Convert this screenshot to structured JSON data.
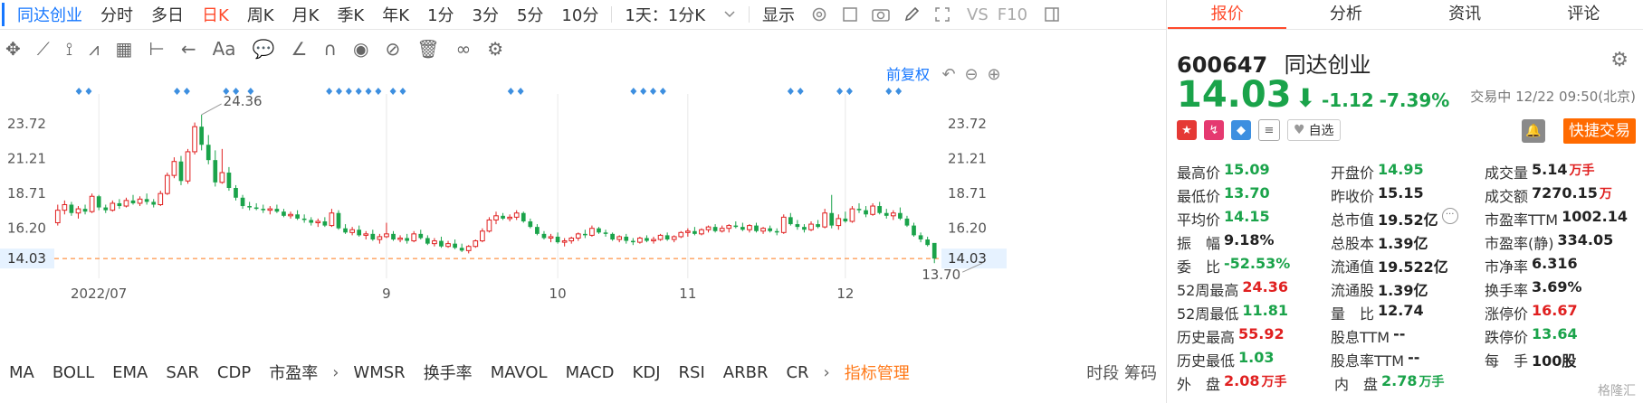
{
  "toolbar": {
    "stock_tab": "同达创业",
    "periods": [
      "分时",
      "多日",
      "日K",
      "周K",
      "月K",
      "季K",
      "年K",
      "1分",
      "3分",
      "5分",
      "10分"
    ],
    "active_period": "日K",
    "range_select": "1天：1分K",
    "display_label": "显示",
    "vs_label": "VS",
    "f10_label": "F10"
  },
  "chart_controls": {
    "adjust_label": "前复权"
  },
  "chart_data": {
    "type": "candlestick",
    "y_ticks": [
      "23.72",
      "21.21",
      "18.71",
      "16.20",
      "14.03"
    ],
    "y_tick_values": [
      23.72,
      21.21,
      18.71,
      16.2,
      14.03
    ],
    "ylim": [
      13.0,
      25.2
    ],
    "x_ticks": [
      {
        "label": "2022/07",
        "index": 6
      },
      {
        "label": "9",
        "index": 48
      },
      {
        "label": "10",
        "index": 73
      },
      {
        "label": "11",
        "index": 92
      },
      {
        "label": "12",
        "index": 115
      }
    ],
    "current_price": 14.03,
    "annotations": [
      {
        "label": "24.36",
        "index": 21,
        "value": 24.36
      },
      {
        "label": "13.70",
        "index": 135,
        "value": 13.7
      }
    ],
    "ohlc": [
      [
        16.6,
        17.9,
        16.4,
        17.5
      ],
      [
        17.5,
        18.2,
        17.2,
        17.9
      ],
      [
        17.9,
        18.1,
        17.1,
        17.3
      ],
      [
        17.3,
        17.8,
        16.9,
        17.6
      ],
      [
        17.6,
        17.9,
        17.2,
        17.4
      ],
      [
        17.4,
        18.7,
        17.3,
        18.5
      ],
      [
        18.5,
        18.6,
        17.5,
        17.7
      ],
      [
        17.7,
        17.9,
        17.3,
        17.5
      ],
      [
        17.5,
        18.2,
        17.4,
        18.0
      ],
      [
        18.0,
        18.3,
        17.6,
        17.8
      ],
      [
        17.8,
        18.4,
        17.7,
        18.2
      ],
      [
        18.2,
        18.6,
        17.9,
        18.0
      ],
      [
        18.0,
        18.5,
        17.8,
        18.3
      ],
      [
        18.3,
        18.7,
        17.9,
        18.1
      ],
      [
        18.1,
        18.3,
        17.7,
        17.9
      ],
      [
        17.9,
        18.9,
        17.8,
        18.7
      ],
      [
        18.7,
        20.2,
        18.6,
        20.0
      ],
      [
        20.0,
        21.3,
        19.8,
        21.0
      ],
      [
        21.0,
        21.4,
        19.3,
        19.6
      ],
      [
        19.6,
        21.9,
        19.4,
        21.7
      ],
      [
        21.7,
        23.8,
        21.5,
        23.5
      ],
      [
        23.5,
        24.36,
        21.8,
        22.2
      ],
      [
        22.2,
        22.9,
        20.8,
        21.1
      ],
      [
        21.1,
        21.8,
        19.2,
        19.5
      ],
      [
        19.5,
        21.9,
        19.4,
        20.2
      ],
      [
        20.2,
        20.6,
        18.9,
        19.1
      ],
      [
        19.1,
        19.3,
        18.2,
        18.4
      ],
      [
        18.4,
        18.6,
        17.6,
        17.8
      ],
      [
        17.8,
        18.1,
        17.5,
        17.7
      ],
      [
        17.7,
        18.0,
        17.5,
        17.6
      ],
      [
        17.6,
        17.9,
        17.3,
        17.5
      ],
      [
        17.5,
        17.8,
        17.2,
        17.6
      ],
      [
        17.6,
        17.9,
        17.3,
        17.4
      ],
      [
        17.4,
        17.6,
        17.0,
        17.1
      ],
      [
        17.1,
        17.4,
        16.9,
        17.2
      ],
      [
        17.2,
        17.5,
        16.8,
        16.9
      ],
      [
        16.9,
        17.2,
        16.6,
        16.8
      ],
      [
        16.8,
        17.0,
        16.4,
        16.6
      ],
      [
        16.6,
        16.9,
        16.3,
        16.7
      ],
      [
        16.7,
        17.0,
        16.3,
        16.4
      ],
      [
        16.4,
        17.6,
        16.3,
        17.3
      ],
      [
        17.3,
        17.5,
        16.1,
        16.2
      ],
      [
        16.2,
        16.5,
        15.8,
        15.9
      ],
      [
        15.9,
        16.3,
        15.7,
        16.1
      ],
      [
        16.1,
        16.4,
        15.6,
        15.7
      ],
      [
        15.7,
        16.0,
        15.4,
        15.8
      ],
      [
        15.8,
        16.1,
        15.3,
        15.4
      ],
      [
        15.4,
        15.8,
        15.1,
        15.6
      ],
      [
        15.6,
        16.6,
        15.5,
        15.8
      ],
      [
        15.8,
        16.0,
        15.3,
        15.4
      ],
      [
        15.4,
        15.7,
        15.2,
        15.5
      ],
      [
        15.5,
        15.8,
        15.1,
        15.3
      ],
      [
        15.3,
        16.0,
        15.2,
        15.8
      ],
      [
        15.8,
        16.1,
        15.4,
        15.5
      ],
      [
        15.5,
        15.7,
        15.0,
        15.1
      ],
      [
        15.1,
        15.5,
        14.9,
        15.3
      ],
      [
        15.3,
        15.6,
        14.8,
        14.9
      ],
      [
        14.9,
        15.3,
        14.8,
        15.1
      ],
      [
        15.1,
        15.4,
        14.7,
        14.8
      ],
      [
        14.8,
        15.1,
        14.5,
        14.6
      ],
      [
        14.6,
        15.0,
        14.4,
        14.9
      ],
      [
        14.9,
        15.4,
        14.8,
        15.3
      ],
      [
        15.3,
        16.2,
        15.2,
        16.0
      ],
      [
        16.0,
        17.0,
        15.9,
        16.8
      ],
      [
        16.8,
        17.4,
        16.5,
        17.1
      ],
      [
        17.1,
        17.3,
        16.8,
        16.9
      ],
      [
        16.9,
        17.2,
        16.7,
        17.0
      ],
      [
        17.0,
        17.5,
        16.8,
        17.3
      ],
      [
        17.3,
        17.4,
        16.6,
        16.7
      ],
      [
        16.7,
        16.9,
        16.2,
        16.3
      ],
      [
        16.3,
        16.5,
        15.7,
        15.8
      ],
      [
        15.8,
        16.0,
        15.4,
        15.5
      ],
      [
        15.5,
        15.8,
        15.2,
        15.6
      ],
      [
        15.6,
        15.9,
        15.1,
        15.2
      ],
      [
        15.2,
        15.5,
        14.9,
        15.3
      ],
      [
        15.3,
        15.6,
        15.1,
        15.5
      ],
      [
        15.5,
        15.9,
        15.3,
        15.8
      ],
      [
        15.8,
        16.1,
        15.5,
        15.7
      ],
      [
        15.7,
        16.4,
        15.6,
        16.2
      ],
      [
        16.2,
        16.3,
        15.8,
        15.9
      ],
      [
        15.9,
        16.1,
        15.6,
        15.8
      ],
      [
        15.8,
        15.9,
        15.3,
        15.4
      ],
      [
        15.4,
        15.7,
        15.2,
        15.6
      ],
      [
        15.6,
        15.8,
        15.1,
        15.3
      ],
      [
        15.3,
        15.5,
        15.0,
        15.2
      ],
      [
        15.2,
        15.6,
        15.1,
        15.5
      ],
      [
        15.5,
        15.7,
        15.2,
        15.3
      ],
      [
        15.3,
        15.6,
        15.1,
        15.4
      ],
      [
        15.4,
        15.8,
        15.3,
        15.7
      ],
      [
        15.7,
        15.9,
        15.3,
        15.4
      ],
      [
        15.4,
        15.7,
        15.2,
        15.6
      ],
      [
        15.6,
        16.0,
        15.5,
        15.9
      ],
      [
        15.9,
        16.2,
        15.6,
        16.0
      ],
      [
        16.0,
        16.3,
        15.7,
        15.8
      ],
      [
        15.8,
        16.2,
        15.7,
        16.1
      ],
      [
        16.1,
        16.4,
        15.9,
        16.3
      ],
      [
        16.3,
        16.5,
        15.9,
        16.0
      ],
      [
        16.0,
        16.4,
        15.9,
        16.2
      ],
      [
        16.2,
        16.5,
        15.9,
        16.4
      ],
      [
        16.4,
        16.7,
        16.2,
        16.3
      ],
      [
        16.3,
        16.6,
        16.0,
        16.1
      ],
      [
        16.1,
        16.5,
        15.9,
        16.4
      ],
      [
        16.4,
        16.6,
        15.9,
        16.0
      ],
      [
        16.0,
        16.3,
        15.8,
        16.2
      ],
      [
        16.2,
        16.4,
        15.9,
        16.0
      ],
      [
        16.0,
        16.2,
        15.7,
        15.9
      ],
      [
        15.9,
        17.2,
        15.8,
        17.0
      ],
      [
        17.0,
        17.3,
        16.4,
        16.5
      ],
      [
        16.5,
        16.8,
        16.1,
        16.3
      ],
      [
        16.3,
        16.5,
        15.9,
        16.1
      ],
      [
        16.1,
        16.7,
        16.0,
        16.5
      ],
      [
        16.5,
        16.8,
        16.2,
        16.3
      ],
      [
        16.3,
        17.6,
        16.2,
        17.3
      ],
      [
        17.3,
        18.6,
        16.2,
        16.4
      ],
      [
        16.4,
        17.2,
        16.1,
        16.9
      ],
      [
        16.9,
        17.4,
        16.6,
        16.7
      ],
      [
        16.7,
        17.8,
        16.6,
        17.6
      ],
      [
        17.6,
        18.0,
        17.3,
        17.5
      ],
      [
        17.5,
        17.8,
        17.0,
        17.2
      ],
      [
        17.2,
        18.0,
        17.1,
        17.8
      ],
      [
        17.8,
        18.1,
        17.2,
        17.3
      ],
      [
        17.3,
        17.6,
        16.9,
        17.1
      ],
      [
        17.1,
        17.5,
        16.8,
        17.3
      ],
      [
        17.3,
        17.7,
        16.8,
        16.9
      ],
      [
        16.9,
        17.1,
        16.3,
        16.4
      ],
      [
        16.4,
        16.6,
        15.6,
        15.7
      ],
      [
        15.7,
        15.9,
        15.2,
        15.4
      ],
      [
        15.4,
        15.6,
        14.9,
        15.0
      ],
      [
        15.15,
        14.95,
        13.7,
        14.03
      ]
    ],
    "marker_indices": [
      5,
      7,
      25,
      27,
      35,
      37,
      40,
      56,
      58,
      60,
      62,
      64,
      66,
      69,
      71,
      93,
      95,
      118,
      120,
      122,
      124,
      150,
      152,
      160,
      162,
      170,
      172
    ]
  },
  "indicators": {
    "items": [
      "MA",
      "BOLL",
      "EMA",
      "SAR",
      "CDP",
      "市盈率",
      "WMSR",
      "换手率",
      "MAVOL",
      "MACD",
      "KDJ",
      "RSI",
      "ARBR",
      "CR"
    ],
    "manage_label": "指标管理",
    "extra": "时段 筹码"
  },
  "panel": {
    "tabs": [
      "报价",
      "分析",
      "资讯",
      "评论"
    ],
    "active_tab": "报价",
    "code": "600647",
    "name": "同达创业",
    "price": "14.03",
    "change": "-1.12",
    "change_pct": "-7.39%",
    "status": "交易中 12/22 09:50(北京)",
    "watch_label": "自选",
    "quick_trade_label": "快捷交易",
    "stats": [
      [
        {
          "label": "最高价",
          "value": "15.09",
          "color": "green"
        },
        {
          "label": "开盘价",
          "value": "14.95",
          "color": "green"
        },
        {
          "label": "成交量",
          "value": "5.14",
          "unit": "万手",
          "color": "black"
        }
      ],
      [
        {
          "label": "最低价",
          "value": "13.70",
          "color": "green"
        },
        {
          "label": "昨收价",
          "value": "15.15",
          "color": "black"
        },
        {
          "label": "成交额",
          "value": "7270.15",
          "unit": "万",
          "color": "black"
        }
      ],
      [
        {
          "label": "平均价",
          "value": "14.15",
          "color": "green"
        },
        {
          "label": "总市值",
          "value": "19.52亿",
          "color": "black",
          "more": true
        },
        {
          "label": "市盈率TTM",
          "value": "1002.14",
          "color": "black"
        }
      ],
      [
        {
          "label": "振　幅",
          "value": "9.18%",
          "color": "black"
        },
        {
          "label": "总股本",
          "value": "1.39亿",
          "color": "black"
        },
        {
          "label": "市盈率(静)",
          "value": "334.05",
          "color": "black"
        }
      ],
      [
        {
          "label": "委　比",
          "value": "-52.53%",
          "color": "green"
        },
        {
          "label": "流通值",
          "value": "19.522亿",
          "color": "black"
        },
        {
          "label": "市净率",
          "value": "6.316",
          "color": "black"
        }
      ],
      [
        {
          "label": "52周最高",
          "value": "24.36",
          "color": "red"
        },
        {
          "label": "流通股",
          "value": "1.39亿",
          "color": "black"
        },
        {
          "label": "换手率",
          "value": "3.69%",
          "color": "black"
        }
      ],
      [
        {
          "label": "52周最低",
          "value": "11.81",
          "color": "green"
        },
        {
          "label": "量　比",
          "value": "12.74",
          "color": "black"
        },
        {
          "label": "涨停价",
          "value": "16.67",
          "color": "red"
        }
      ],
      [
        {
          "label": "历史最高",
          "value": "55.92",
          "color": "red"
        },
        {
          "label": "股息TTM",
          "value": "--",
          "color": "black"
        },
        {
          "label": "跌停价",
          "value": "13.64",
          "color": "green"
        }
      ],
      [
        {
          "label": "历史最低",
          "value": "1.03",
          "color": "green"
        },
        {
          "label": "股息率TTM",
          "value": "--",
          "color": "black"
        },
        {
          "label": "每　手",
          "value": "100股",
          "color": "black"
        }
      ],
      [
        {
          "label": "外　盘",
          "value": "2.08",
          "unit": "万手",
          "color": "red"
        },
        {
          "label": "内　盘",
          "value": "2.78",
          "unit": "万手",
          "color": "green"
        }
      ]
    ],
    "watermark": "格隆汇"
  }
}
